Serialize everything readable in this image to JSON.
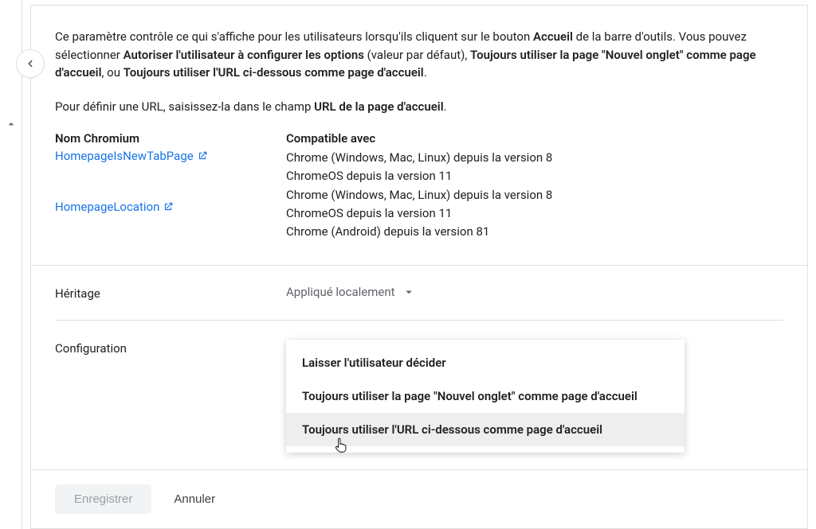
{
  "description": {
    "p1_seg1": "Ce paramètre contrôle ce qui s'affiche pour les utilisateurs lorsqu'ils cliquent sur le bouton ",
    "p1_bold1": "Accueil",
    "p1_seg2": " de la barre d'outils. Vous pouvez sélectionner ",
    "p1_bold2": "Autoriser l'utilisateur à configurer les options",
    "p1_seg3": " (valeur par défaut), ",
    "p1_bold3": "Toujours utiliser la page \"Nouvel onglet\" comme page d'accueil",
    "p1_seg4": ", ou ",
    "p1_bold4": "Toujours utiliser l'URL ci-dessous comme page d'accueil",
    "p1_seg5": ".",
    "p2_seg1": "Pour définir une URL, saisissez-la dans le champ ",
    "p2_bold1": "URL de la page d'accueil",
    "p2_seg2": "."
  },
  "policy": {
    "name_header": "Nom Chromium",
    "compat_header": "Compatible avec",
    "links": [
      "HomepageIsNewTabPage",
      "HomepageLocation"
    ],
    "compat1": [
      "Chrome (Windows, Mac, Linux) depuis la version 8",
      "ChromeOS depuis la version 11"
    ],
    "compat2": [
      "Chrome (Windows, Mac, Linux) depuis la version 8",
      "ChromeOS depuis la version 11",
      "Chrome (Android) depuis la version 81"
    ]
  },
  "settings": {
    "inheritance_label": "Héritage",
    "inheritance_value": "Appliqué localement",
    "configuration_label": "Configuration",
    "options": [
      "Laisser l'utilisateur décider",
      "Toujours utiliser la page \"Nouvel onglet\" comme page d'accueil",
      "Toujours utiliser l'URL ci-dessous comme page d'accueil"
    ]
  },
  "actions": {
    "save": "Enregistrer",
    "cancel": "Annuler"
  }
}
